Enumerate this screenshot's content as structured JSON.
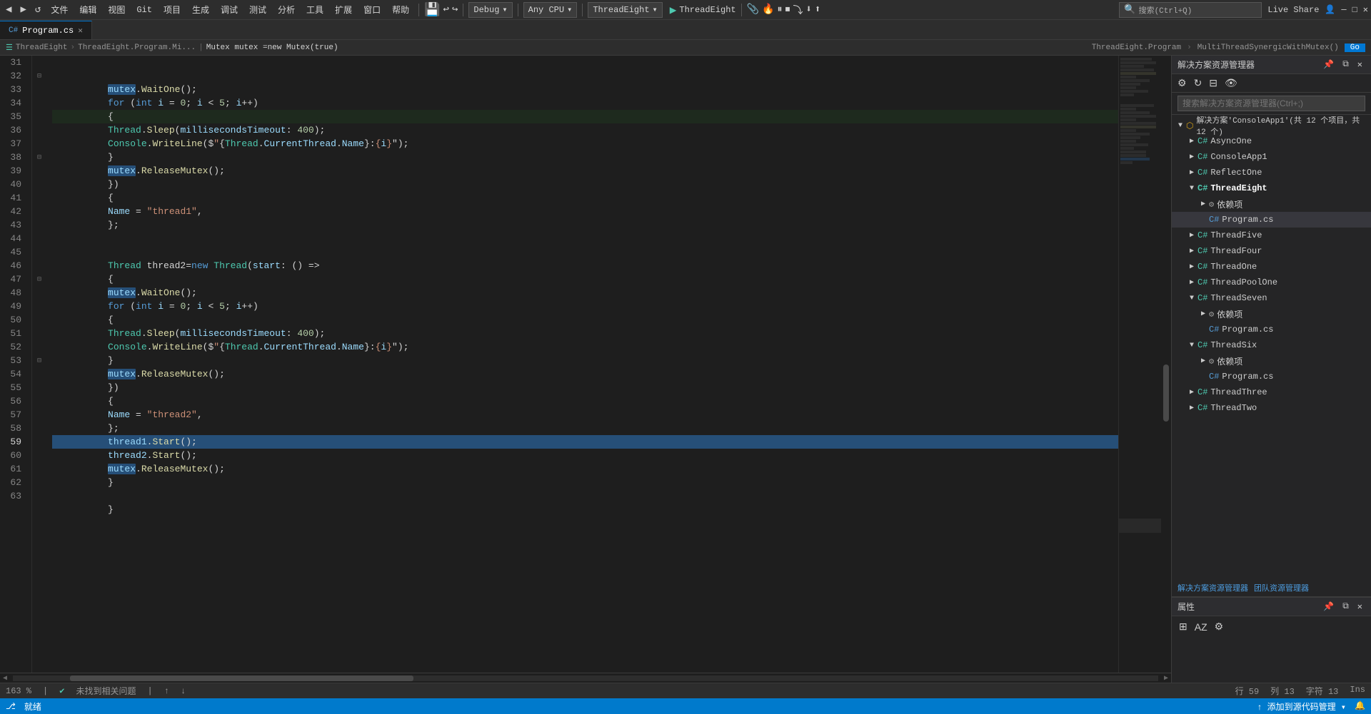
{
  "toolbar": {
    "back_btn": "◀",
    "forward_btn": "▶",
    "debug_mode": "Debug",
    "cpu_target": "Any CPU",
    "thread_name": "ThreadEight",
    "run_btn": "▶",
    "run_label": "ThreadEight",
    "live_share": "Live Share",
    "user": "用户",
    "search_placeholder": "搜索(Ctrl+Q)"
  },
  "tabs": [
    {
      "name": "Program.cs",
      "active": true
    },
    {
      "name": "×",
      "active": false
    }
  ],
  "breadcrumbs": {
    "thread": "ThreadEight",
    "class_path": "ThreadEight.Program.Mi...",
    "class_full": "Mutex mutex =new Mutex(true)",
    "namespace_path": "ThreadEight.Program",
    "method": "MultiThreadSynergicWithMutex()"
  },
  "code": {
    "lines": [
      {
        "num": 31,
        "indent": 3,
        "text": "mutex.WaitOne();"
      },
      {
        "num": 32,
        "indent": 3,
        "text": "for (int i = 0; i < 5; i++)"
      },
      {
        "num": 33,
        "indent": 3,
        "text": "{"
      },
      {
        "num": 34,
        "indent": 4,
        "text": "Thread.Sleep(millisecondsTimeout: 400);"
      },
      {
        "num": 35,
        "indent": 4,
        "text": "Console.WriteLine($\"{Thread.CurrentThread.Name}:{i}\");"
      },
      {
        "num": 36,
        "indent": 3,
        "text": "}"
      },
      {
        "num": 37,
        "indent": 3,
        "text": "mutex.ReleaseMutex();"
      },
      {
        "num": 38,
        "indent": 2,
        "text": "})"
      },
      {
        "num": 39,
        "indent": 2,
        "text": "{"
      },
      {
        "num": 40,
        "indent": 3,
        "text": "Name = \"thread1\","
      },
      {
        "num": 41,
        "indent": 2,
        "text": "};"
      },
      {
        "num": 42,
        "indent": 0,
        "text": ""
      },
      {
        "num": 43,
        "indent": 0,
        "text": ""
      },
      {
        "num": 44,
        "indent": 2,
        "text": "Thread thread2=new Thread(start: () =>"
      },
      {
        "num": 45,
        "indent": 2,
        "text": "{"
      },
      {
        "num": 46,
        "indent": 3,
        "text": "mutex.WaitOne();"
      },
      {
        "num": 47,
        "indent": 3,
        "text": "for (int i = 0; i < 5; i++)"
      },
      {
        "num": 48,
        "indent": 3,
        "text": "{"
      },
      {
        "num": 49,
        "indent": 4,
        "text": "Thread.Sleep(millisecondsTimeout: 400);"
      },
      {
        "num": 50,
        "indent": 4,
        "text": "Console.WriteLine($\"{Thread.CurrentThread.Name}:{i}\");"
      },
      {
        "num": 51,
        "indent": 3,
        "text": "}"
      },
      {
        "num": 52,
        "indent": 3,
        "text": "mutex.ReleaseMutex();"
      },
      {
        "num": 53,
        "indent": 2,
        "text": "})"
      },
      {
        "num": 54,
        "indent": 2,
        "text": "{"
      },
      {
        "num": 55,
        "indent": 3,
        "text": "Name = \"thread2\","
      },
      {
        "num": 56,
        "indent": 2,
        "text": "};"
      },
      {
        "num": 57,
        "indent": 2,
        "text": "thread1.Start();"
      },
      {
        "num": 58,
        "indent": 2,
        "text": "thread2.Start();"
      },
      {
        "num": 59,
        "indent": 2,
        "text": "mutex.ReleaseMutex();"
      },
      {
        "num": 60,
        "indent": 1,
        "text": "}"
      },
      {
        "num": 61,
        "indent": 0,
        "text": ""
      },
      {
        "num": 62,
        "indent": 1,
        "text": "}"
      },
      {
        "num": 63,
        "indent": 0,
        "text": ""
      }
    ]
  },
  "solution_panel": {
    "title": "解决方案资源管理器",
    "search_placeholder": "搜索解决方案资源管理器(Ctrl+;)",
    "solution_label": "解决方案'ConsoleApp1'(共 12 个项目，共 12 个)",
    "items": [
      {
        "name": "AsyncOne",
        "type": "project",
        "level": 1
      },
      {
        "name": "ConsoleApp1",
        "type": "project",
        "level": 1
      },
      {
        "name": "ReflectOne",
        "type": "project",
        "level": 1
      },
      {
        "name": "ThreadEight",
        "type": "project",
        "level": 1,
        "expanded": true,
        "bold": true
      },
      {
        "name": "依赖项",
        "type": "folder",
        "level": 2
      },
      {
        "name": "Program.cs",
        "type": "file",
        "level": 2,
        "selected": true
      },
      {
        "name": "ThreadFive",
        "type": "project",
        "level": 1
      },
      {
        "name": "ThreadFour",
        "type": "project",
        "level": 1
      },
      {
        "name": "ThreadOne",
        "type": "project",
        "level": 1
      },
      {
        "name": "ThreadPoolOne",
        "type": "project",
        "level": 1
      },
      {
        "name": "ThreadSeven",
        "type": "project",
        "level": 1,
        "expanded": true
      },
      {
        "name": "依赖项",
        "type": "folder",
        "level": 2
      },
      {
        "name": "Program.cs",
        "type": "file",
        "level": 2
      },
      {
        "name": "ThreadSix",
        "type": "project",
        "level": 1,
        "expanded": true
      },
      {
        "name": "依赖项",
        "type": "folder",
        "level": 2
      },
      {
        "name": "Program.cs",
        "type": "file",
        "level": 2
      },
      {
        "name": "ThreadThree",
        "type": "project",
        "level": 1
      },
      {
        "name": "ThreadTwo",
        "type": "project",
        "level": 1
      }
    ]
  },
  "panel_links": {
    "solution_mgr": "解决方案资源管理器",
    "team_explorer": "团队资源管理器"
  },
  "properties_panel": {
    "title": "属性"
  },
  "status_bar": {
    "ready": "就绪",
    "no_issues": "未找到相关问题",
    "row": "行 59",
    "col": "列 13",
    "char": "字符 13",
    "ins": "Ins",
    "zoom": "163 %",
    "add_to_source": "↑ 添加到源代码管理 ▾"
  }
}
